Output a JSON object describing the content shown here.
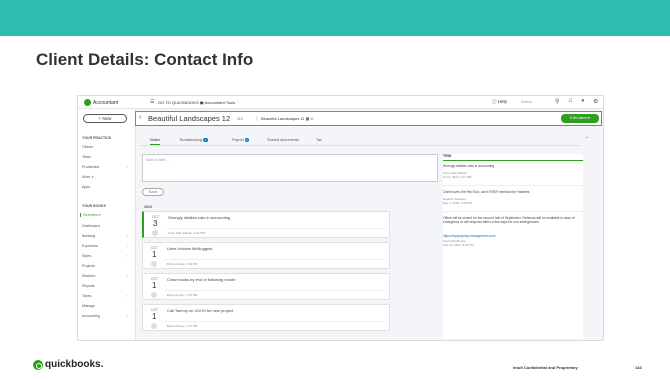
{
  "slide": {
    "title": "Client Details: Contact Info",
    "footer_brand": "quickbooks.",
    "footer_text": "Intuit Confidential and Proprietary",
    "page_number": "143"
  },
  "app": {
    "brand": "Accountant",
    "goto": "GO TO QUICKBOOKS ▾",
    "accountant_tools": "Accountant Tools",
    "help": "Help",
    "search": "Search"
  },
  "sidebar": {
    "new_button": "+ New",
    "practice_header": "YOUR PRACTICE",
    "practice_items": [
      "Clients",
      "Team",
      "ProAdvisor",
      "Work",
      "Apps"
    ],
    "books_header": "YOUR BOOKS",
    "books_items": [
      "Overview",
      "Dashboard",
      "Banking",
      "Expenses",
      "Sales",
      "Projects",
      "Workers",
      "Reports",
      "Taxes",
      "Mileage",
      "Accounting"
    ]
  },
  "client": {
    "name": "Beautiful Landscapes 12",
    "count": "2",
    "switcher": "Beautiful Landscapes 11",
    "edit_button": "Edit client"
  },
  "tabs": [
    {
      "label": "Notes"
    },
    {
      "label": "Bookkeeping",
      "badge": "1"
    },
    {
      "label": "Payroll",
      "badge": "0"
    },
    {
      "label": "Shared documents"
    },
    {
      "label": "Tax"
    }
  ],
  "notes": {
    "placeholder": "Add a note...",
    "save": "Save",
    "year": "2019",
    "items": [
      {
        "month": "OCT",
        "day": "3",
        "text": "Strongly dislikes cats in accounting",
        "by": "Anna Kate Palmer, 1:01 PM"
      },
      {
        "month": "OCT",
        "day": "1",
        "text": "Likes chicken McNuggets",
        "by": "Bryce Kinney, 7:10 PM"
      },
      {
        "month": "OCT",
        "day": "1",
        "text": "Close books by end of following month",
        "by": "Bryce Kinney, 7:10 PM"
      },
      {
        "month": "OCT",
        "day": "1",
        "text": "Call Tammy on 4/1/19 for new project",
        "by": "Bryce Kinney, 7:10 PM"
      }
    ]
  },
  "activity": {
    "title": "TRID",
    "entries": [
      {
        "text": "Strongly dislikes cats in accounting",
        "meta": "Anna Kate Palmer\nOct 3, 2019, 1:01 PM"
      },
      {
        "text": "Client loves the Red Sox, don't EVER mention the Yankees",
        "meta": "Heather Salerday\nSep 4, 2019, 2:20 PM"
      },
      {
        "text": "Office will be closed for the second half of September. Rebecca will be available in case of emergency or will respond within a few days for non-emergencies.",
        "link": "https://myproperty.management.com/",
        "meta": "Laura Rashinsky\nSep 12, 2017, 9:29 PM"
      }
    ]
  }
}
